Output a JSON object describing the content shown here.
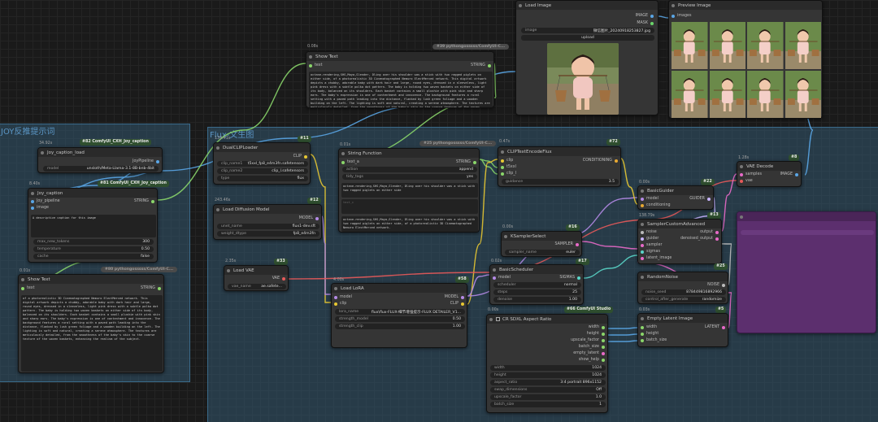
{
  "groups": {
    "joy": "JOY反推提示词",
    "flux": "Flux-文生图"
  },
  "colors": {
    "wire_blue": "#5aa6e6",
    "wire_yellow": "#e8c832",
    "wire_purple": "#b48ae6",
    "wire_red": "#e85a5a",
    "wire_green": "#8ad66a",
    "wire_pink": "#e86ac8",
    "wire_cyan": "#5ad6c8",
    "wire_lavender": "#c8b4ff",
    "wire_white": "#bbbbbb",
    "group_bg": "#335870"
  },
  "nodes": {
    "load_image": {
      "title": "Load Image",
      "out1": "IMAGE",
      "out2": "MASK",
      "image_label": "image",
      "image_value": "微信图片_20240918253827.jpg",
      "upload": "upload"
    },
    "preview_image": {
      "title": "Preview Image",
      "in1": "images"
    },
    "show_text_top": {
      "time": "0.08s",
      "tag": "#39 pythongosssss/ComfyUI-C...",
      "title": "Show Text",
      "in": "text",
      "out": "STRING",
      "text": "octane-rendering,SHS,Maya,Slender, Dling over his shoulder was a stick with two ragged piglets on either side, of a photorealistic 3D Cinematographed Nemuro ElectMerced network. This digital artwork depicts a chubby, adorable baby with dark hair and large, round eyes, dressed in a sleeveless, light pink dress with a subtle polka dot pattern. The baby is holding two woven baskets on either side of its body, balanced on its shoulders. Each basket contains a small plushie with pink skin and sharp ears. The baby's expression is one of contentment and innocence. The background features a rural setting with a paved path leading into the distance, flanked by lush green foliage and a wooden building on the left. The lighting is soft and natural, creating a serene atmosphere. The textures are meticulously detailed, from the smoothness of the baby's skin to the coarse texture of the woven baskets."
    },
    "joy_caption_load": {
      "time": "34.92s",
      "tag": "#82 ComfyUI_CXH_Joy_caption",
      "title": "Joy_caption_load",
      "out": "JoyPipeline",
      "model_label": "model",
      "model_value": "unsloth/Meta-Llama-3.1-8B-bnb-4bit"
    },
    "joy_caption": {
      "time": "8.40s",
      "tag": "#81 ComfyUI_CXH_Joy_caption",
      "title": "Joy_caption",
      "in1": "Joy_pipeline",
      "in2": "image",
      "out": "STRING",
      "prompt": "A descriptive caption for this image",
      "max_new_tokens_label": "max_new_tokens",
      "max_new_tokens": "300",
      "temperature_label": "temperature",
      "temperature": "0.50",
      "cache_label": "cache",
      "cache": "false"
    },
    "show_text_left": {
      "time": "0.01s",
      "tag": "#80 pythongosssss/ComfyUI-C...",
      "title": "Show Text",
      "in": "text",
      "out": "STRING",
      "text": "of a photorealistic 3D Cinematographed Nemuro ElectMerced network. This digital artwork depicts a chubby, adorable baby with dark hair and large, round eyes, dressed in a sleeveless, light pink dress with a subtle polka dot pattern. The baby is holding two woven baskets on either side of its body, balanced on its shoulders. Each basket contains a small plushie with pink skin and sharp ears. The baby's expression is one of contentment and innocence. The background features a rural setting with a paved path leading into the distance, flanked by lush green foliage and a wooden building on the left. The lighting is soft and natural, creating a serene atmosphere. The textures are meticulously detailed, from the smoothness of the baby's skin to the coarse texture of the woven baskets, enhancing the realism of the subject."
    },
    "dual_clip": {
      "time": "139.41s",
      "tag": "#11",
      "title": "DualCLIPLoader",
      "out": "CLIP",
      "clip1_label": "clip_name1",
      "clip1": "t5xxl_fp8_e4m3fn.safetensors",
      "clip2_label": "clip_name2",
      "clip2": "clip_l.safetensors",
      "type_label": "type",
      "type": "flux"
    },
    "load_diffusion": {
      "time": "243.46s",
      "tag": "#12",
      "title": "Load Diffusion Model",
      "out": "MODEL",
      "unet_label": "unet_name",
      "unet": "flux1-dev.sft",
      "dtype_label": "weight_dtype",
      "dtype": "fp8_e4m3fn"
    },
    "load_vae": {
      "time": "2.35s",
      "tag": "#33",
      "title": "Load VAE",
      "out": "VAE",
      "vae_label": "vae_name",
      "vae": "ae.safete..."
    },
    "string_function": {
      "time": "0.01s",
      "tag": "#25 pythongosssss/ComfyUI-C...",
      "title": "String Function",
      "in": "text_a",
      "out": "STRING",
      "action_label": "action",
      "action": "append",
      "tidy_label": "tidy_tags",
      "tidy": "yes",
      "text_b": "octane-rendering,SHS,Maya,Slender, Dling over his shoulder was a stick with two ragged piglets on either side",
      "text_c": "text_c",
      "result": "octane-rendering,SHS,Maya,Slender, Dling over his shoulder was a stick with two ragged piglets on either side, of a photorealistic 3D Cinematographed Nemuro ElectMerced network."
    },
    "load_lora": {
      "time": "4.00s",
      "tag": "#58",
      "title": "Load LoRA",
      "in1": "model",
      "in2": "clip",
      "out1": "MODEL",
      "out2": "CLIP",
      "lora_label": "lora_name",
      "lora": "flux\\flux-FLUX-细节增强提示-FLUX DETAILER_V1...",
      "sm_label": "strength_model",
      "sm": "0.50",
      "sc_label": "strength_clip",
      "sc": "1.00"
    },
    "clip_encode": {
      "time": "0.47s",
      "tag": "#72",
      "title": "CLIPTextEncodeFlux",
      "in1": "clip",
      "in2": "t5xxl",
      "in3": "clip_l",
      "out": "CONDITIONING",
      "g_label": "guidance",
      "g": "3.5"
    },
    "ksampler_select": {
      "time": "0.00s",
      "tag": "#16",
      "title": "KSamplerSelect",
      "out": "SAMPLER",
      "s_label": "sampler_name",
      "s": "euler"
    },
    "basic_scheduler": {
      "time": "0.02s",
      "tag": "#17",
      "title": "BasicScheduler",
      "in": "model",
      "out": "SIGMAS",
      "sch_label": "scheduler",
      "sch": "normal",
      "steps_label": "steps",
      "steps": "25",
      "denoise_label": "denoise",
      "denoise": "1.00"
    },
    "sdxl_ratio": {
      "time": "0.00s",
      "tag": "#66 ComfyUI Studio",
      "title": "CR SDXL Aspect Ratio",
      "out1": "width",
      "out2": "height",
      "out3": "upscale_factor",
      "out4": "batch_size",
      "out5": "empty_latent",
      "out6": "show_help",
      "w_label": "width",
      "w": "1024",
      "h_label": "height",
      "h": "1024",
      "ar_label": "aspect_ratio",
      "ar": "3:4 portrait 896x1152",
      "swap_label": "swap_dimensions",
      "swap": "Off",
      "uf_label": "upscale_factor",
      "uf": "1.0",
      "bs_label": "batch_size",
      "bs": "1"
    },
    "basic_guider": {
      "time": "0.00s",
      "tag": "#22",
      "title": "BasicGuider",
      "in1": "model",
      "in2": "conditioning",
      "out": "GUIDER"
    },
    "sampler_custom": {
      "time": "138.79s",
      "tag": "#13",
      "title": "SamplerCustomAdvanced",
      "in1": "noise",
      "in2": "guider",
      "in3": "sampler",
      "in4": "sigmas",
      "in5": "latent_image",
      "out1": "output",
      "out2": "denoised_output"
    },
    "random_noise": {
      "tag": "#25",
      "title": "RandomNoise",
      "out": "NOISE",
      "seed_label": "noise_seed",
      "seed": "878449816892966",
      "cag_label": "control_after_generate",
      "cag": "randomize"
    },
    "empty_latent": {
      "time": "0.03s",
      "tag": "#5",
      "title": "Empty Latent Image",
      "in1": "width",
      "in2": "height",
      "in3": "batch_size",
      "out": "LATENT"
    },
    "vae_decode": {
      "time": "1.28s",
      "tag": "#8",
      "title": "VAE Decode",
      "in1": "samples",
      "in2": "vae",
      "out": "IMAGE"
    }
  }
}
